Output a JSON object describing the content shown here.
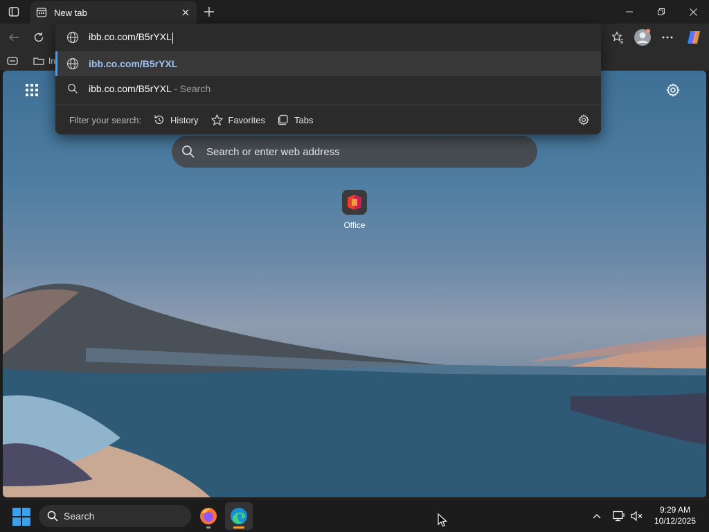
{
  "browser": {
    "tab": {
      "title": "New tab"
    },
    "favorites_bar": {
      "items": [
        {
          "label": "In"
        }
      ]
    }
  },
  "address_dropdown": {
    "typed_text": "ibb.co.com/B5rYXL",
    "suggestions": [
      {
        "type": "url",
        "icon": "globe-icon",
        "text": "ibb.co.com/B5rYXL",
        "suffix": ""
      },
      {
        "type": "search",
        "icon": "search-icon",
        "text": "ibb.co.com/B5rYXL",
        "suffix": " - Search"
      }
    ],
    "filter": {
      "label": "Filter your search:",
      "buttons": [
        {
          "label": "History",
          "icon": "history-icon"
        },
        {
          "label": "Favorites",
          "icon": "star-icon"
        },
        {
          "label": "Tabs",
          "icon": "tabs-icon"
        }
      ]
    }
  },
  "new_tab_page": {
    "search_placeholder": "Search or enter web address",
    "tiles": [
      {
        "label": "Office",
        "icon": "office-icon"
      }
    ]
  },
  "taskbar": {
    "search_label": "Search",
    "apps": [
      {
        "name": "firefox",
        "icon": "firefox-icon"
      },
      {
        "name": "edge",
        "icon": "edge-icon",
        "active": true
      }
    ],
    "clock": {
      "time": "9:29 AM",
      "date": "10/12/2025"
    }
  },
  "colors": {
    "accent": "#5b9bd5",
    "link": "#9dc4f5",
    "dropdown_bg": "#2b2b2b",
    "taskbar_bg": "#1c1c1c"
  }
}
